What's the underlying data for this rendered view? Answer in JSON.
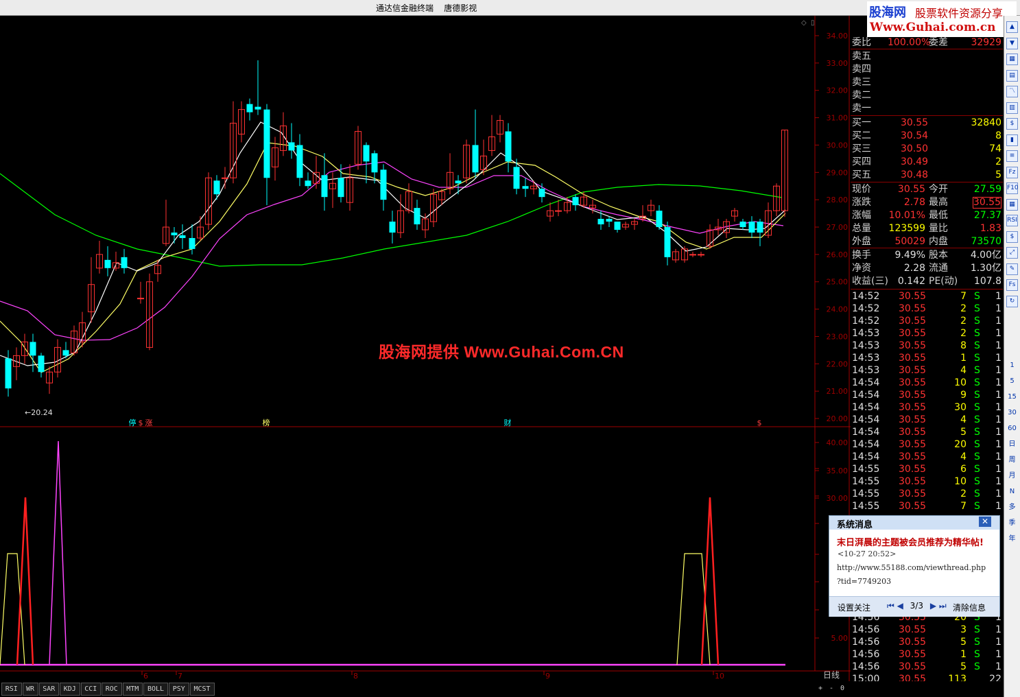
{
  "window": {
    "title": "通达信金融终端    唐德影视"
  },
  "logo": {
    "brand": "股海网",
    "slogan": "股票软件资源分享",
    "url": "Www.Guhai.com.cn"
  },
  "watermark": "股海网提供 Www.Guhai.Com.CN",
  "chart": {
    "price_min_label": "20.24",
    "price_axis": [
      "34.00",
      "33.00",
      "32.00",
      "31.00",
      "30.00",
      "29.00",
      "28.00",
      "27.00",
      "26.00",
      "25.00",
      "24.00",
      "23.00",
      "22.00",
      "21.00",
      "20.00"
    ],
    "indicator_axis": [
      "40.00",
      "35.00",
      "30.00",
      "5.00"
    ],
    "date_ticks": [
      "6",
      "7",
      "8",
      "9",
      "10"
    ],
    "period": "日线",
    "markers": [
      {
        "text": "停",
        "color": "#00ffff"
      },
      {
        "text": "$",
        "color": "#ff4040"
      },
      {
        "text": "涨",
        "color": "#ff4040"
      },
      {
        "text": "榜",
        "color": "#ffff66"
      },
      {
        "text": "财",
        "color": "#00ffff"
      },
      {
        "text": "$",
        "color": "#ff4040"
      }
    ]
  },
  "chart_data": {
    "type": "candlestick",
    "ylim": [
      20,
      34.5
    ],
    "low_annotation": 20.24,
    "last_close": 30.55,
    "ma_colors": {
      "ma5": "#ffffff",
      "ma10": "#ffff66",
      "ma20": "#ff44ff",
      "ma60": "#00ff00"
    }
  },
  "quote": {
    "weibi": {
      "label": "委比",
      "value": "100.00%",
      "label2": "委差",
      "value2": "32929"
    },
    "sells": [
      "卖五",
      "卖四",
      "卖三",
      "卖二",
      "卖一"
    ],
    "buys": [
      {
        "label": "买一",
        "price": "30.55",
        "vol": "32840"
      },
      {
        "label": "买二",
        "price": "30.54",
        "vol": "8"
      },
      {
        "label": "买三",
        "price": "30.50",
        "vol": "74"
      },
      {
        "label": "买四",
        "price": "30.49",
        "vol": "2"
      },
      {
        "label": "买五",
        "price": "30.48",
        "vol": "5"
      }
    ],
    "stats": [
      {
        "l1": "现价",
        "v1": "30.55",
        "l2": "今开",
        "v2": "27.59"
      },
      {
        "l1": "涨跌",
        "v1": "2.78",
        "l2": "最高",
        "v2": "30.55"
      },
      {
        "l1": "涨幅",
        "v1": "10.01%",
        "l2": "最低",
        "v2": "27.37"
      },
      {
        "l1": "总量",
        "v1": "123599",
        "l2": "量比",
        "v2": "1.83"
      },
      {
        "l1": "外盘",
        "v1": "50029",
        "l2": "内盘",
        "v2": "73570"
      }
    ],
    "stats2": [
      {
        "l1": "换手",
        "v1": "9.49%",
        "l2": "股本",
        "v2": "4.00亿"
      },
      {
        "l1": "净资",
        "v1": "2.28",
        "l2": "流通",
        "v2": "1.30亿"
      },
      {
        "l1": "收益(三)",
        "v1": "0.142",
        "l2": "PE(动)",
        "v2": "107.8"
      }
    ],
    "ticks": [
      {
        "t": "14:52",
        "p": "30.55",
        "v": "7",
        "s": "S",
        "n": "1"
      },
      {
        "t": "14:52",
        "p": "30.55",
        "v": "2",
        "s": "S",
        "n": "1"
      },
      {
        "t": "14:52",
        "p": "30.55",
        "v": "2",
        "s": "S",
        "n": "1"
      },
      {
        "t": "14:53",
        "p": "30.55",
        "v": "2",
        "s": "S",
        "n": "1"
      },
      {
        "t": "14:53",
        "p": "30.55",
        "v": "8",
        "s": "S",
        "n": "1"
      },
      {
        "t": "14:53",
        "p": "30.55",
        "v": "1",
        "s": "S",
        "n": "1"
      },
      {
        "t": "14:53",
        "p": "30.55",
        "v": "4",
        "s": "S",
        "n": "1"
      },
      {
        "t": "14:54",
        "p": "30.55",
        "v": "10",
        "s": "S",
        "n": "1"
      },
      {
        "t": "14:54",
        "p": "30.55",
        "v": "9",
        "s": "S",
        "n": "1"
      },
      {
        "t": "14:54",
        "p": "30.55",
        "v": "30",
        "s": "S",
        "n": "1"
      },
      {
        "t": "14:54",
        "p": "30.55",
        "v": "4",
        "s": "S",
        "n": "1"
      },
      {
        "t": "14:54",
        "p": "30.55",
        "v": "5",
        "s": "S",
        "n": "1"
      },
      {
        "t": "14:54",
        "p": "30.55",
        "v": "20",
        "s": "S",
        "n": "1"
      },
      {
        "t": "14:54",
        "p": "30.55",
        "v": "4",
        "s": "S",
        "n": "1"
      },
      {
        "t": "14:55",
        "p": "30.55",
        "v": "6",
        "s": "S",
        "n": "1"
      },
      {
        "t": "14:55",
        "p": "30.55",
        "v": "10",
        "s": "S",
        "n": "1"
      },
      {
        "t": "14:55",
        "p": "30.55",
        "v": "2",
        "s": "S",
        "n": "1"
      },
      {
        "t": "14:55",
        "p": "30.55",
        "v": "7",
        "s": "S",
        "n": "1"
      }
    ],
    "ticks_bottom": [
      {
        "t": "14:56",
        "p": "30.55",
        "v": "20",
        "s": "S",
        "n": "1"
      },
      {
        "t": "14:56",
        "p": "30.55",
        "v": "3",
        "s": "S",
        "n": "1"
      },
      {
        "t": "14:56",
        "p": "30.55",
        "v": "5",
        "s": "S",
        "n": "1"
      },
      {
        "t": "14:56",
        "p": "30.55",
        "v": "1",
        "s": "S",
        "n": "1"
      },
      {
        "t": "14:56",
        "p": "30.55",
        "v": "5",
        "s": "S",
        "n": "1"
      },
      {
        "t": "15:00",
        "p": "30.55",
        "v": "113",
        "s": "",
        "n": "22"
      }
    ]
  },
  "popup": {
    "title": "系统消息",
    "close": "✕",
    "message": "末日湃晨的主题被会员推荐为精华帖!",
    "time": "<10-27 20:52>",
    "url1": "http://www.55188.com/viewthread.php",
    "url2": "?tid=7749203",
    "follow": "设置关注",
    "nav_prev": "⏮ ◀",
    "page": "3/3",
    "nav_next": "▶ ⏭",
    "clear": "清除信息"
  },
  "tabs": [
    "RSI",
    "WR",
    "SAR",
    "KDJ",
    "CCI",
    "ROC",
    "MTM",
    "BOLL",
    "PSY",
    "MCST"
  ],
  "zoom_controls": [
    "+",
    "-",
    "0"
  ],
  "sidebar": {
    "icons": [
      "up-arrow-icon",
      "down-arrow-icon",
      "grid-icon",
      "table-icon",
      "line-chart-icon",
      "candle-icon",
      "money-icon",
      "bar-chart-icon",
      "list-icon",
      "fz-icon",
      "f10-icon",
      "table2-icon",
      "rsi-icon",
      "dollar-icon",
      "arrow-icon",
      "pen-icon",
      "fs-icon",
      "refresh-icon"
    ],
    "labels": [
      "RSI",
      "Fz",
      "Fs"
    ],
    "periods": [
      "1",
      "5",
      "15",
      "30",
      "60",
      "日",
      "周",
      "月",
      "N",
      "多",
      "季",
      "年"
    ]
  }
}
